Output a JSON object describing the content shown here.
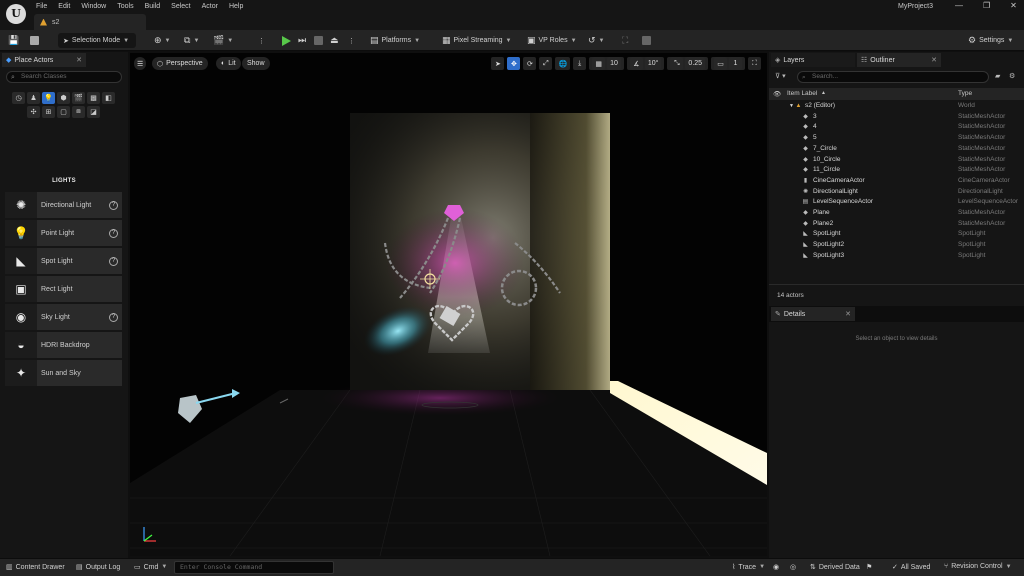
{
  "menu": [
    "File",
    "Edit",
    "Window",
    "Tools",
    "Build",
    "Select",
    "Actor",
    "Help"
  ],
  "level_tab": "s2",
  "project_name": "MyProject3",
  "toolbar": {
    "selection_mode": "Selection Mode",
    "platforms": "Platforms",
    "pixel_streaming": "Pixel Streaming",
    "vp_roles": "VP Roles",
    "settings": "Settings"
  },
  "place_actors": {
    "tab_label": "Place Actors",
    "search_placeholder": "Search Classes",
    "category_title": "LIGHTS",
    "items": [
      {
        "label": "Directional Light",
        "icon": "directional-light-icon",
        "glyph": "✺",
        "help": true
      },
      {
        "label": "Point Light",
        "icon": "point-light-icon",
        "glyph": "💡",
        "help": true
      },
      {
        "label": "Spot Light",
        "icon": "spot-light-icon",
        "glyph": "◣",
        "help": true
      },
      {
        "label": "Rect Light",
        "icon": "rect-light-icon",
        "glyph": "▣",
        "help": false
      },
      {
        "label": "Sky Light",
        "icon": "sky-light-icon",
        "glyph": "◉",
        "help": true
      },
      {
        "label": "HDRI Backdrop",
        "icon": "hdri-backdrop-icon",
        "glyph": "◒",
        "help": false
      },
      {
        "label": "Sun and Sky",
        "icon": "sun-and-sky-icon",
        "glyph": "✦",
        "help": false
      }
    ]
  },
  "viewport": {
    "perspective": "Perspective",
    "lit": "Lit",
    "show": "Show",
    "grid_snap": "10",
    "rotation_snap": "10°",
    "scale_snap": "0.25",
    "camera_speed": "1"
  },
  "outliner": {
    "layers_tab": "Layers",
    "outliner_tab": "Outliner",
    "search_placeholder": "Search...",
    "col_label": "Item Label",
    "col_type": "Type",
    "world_row": {
      "name": "s2 (Editor)",
      "type": "World"
    },
    "rows": [
      {
        "name": "3",
        "type": "StaticMeshActor",
        "icon": "static-mesh-icon"
      },
      {
        "name": "4",
        "type": "StaticMeshActor",
        "icon": "static-mesh-icon"
      },
      {
        "name": "5",
        "type": "StaticMeshActor",
        "icon": "static-mesh-icon"
      },
      {
        "name": "7_Circle",
        "type": "StaticMeshActor",
        "icon": "static-mesh-icon"
      },
      {
        "name": "10_Circle",
        "type": "StaticMeshActor",
        "icon": "static-mesh-icon"
      },
      {
        "name": "11_Circle",
        "type": "StaticMeshActor",
        "icon": "static-mesh-icon"
      },
      {
        "name": "CineCameraActor",
        "type": "CineCameraActor",
        "icon": "camera-icon"
      },
      {
        "name": "DirectionalLight",
        "type": "DirectionalLight",
        "icon": "directional-light-icon"
      },
      {
        "name": "LevelSequenceActor",
        "type": "LevelSequenceActor",
        "icon": "sequence-icon"
      },
      {
        "name": "Plane",
        "type": "StaticMeshActor",
        "icon": "static-mesh-icon"
      },
      {
        "name": "Plane2",
        "type": "StaticMeshActor",
        "icon": "static-mesh-icon"
      },
      {
        "name": "SpotLight",
        "type": "SpotLight",
        "icon": "spot-light-icon"
      },
      {
        "name": "SpotLight2",
        "type": "SpotLight",
        "icon": "spot-light-icon"
      },
      {
        "name": "SpotLight3",
        "type": "SpotLight",
        "icon": "spot-light-icon"
      }
    ],
    "actor_count": "14 actors"
  },
  "details": {
    "tab_label": "Details",
    "empty_text": "Select an object to view details"
  },
  "statusbar": {
    "content_drawer": "Content Drawer",
    "output_log": "Output Log",
    "cmd": "Cmd",
    "console_placeholder": "Enter Console Command",
    "trace": "Trace",
    "derived_data": "Derived Data",
    "all_saved": "All Saved",
    "revision_control": "Revision Control"
  }
}
